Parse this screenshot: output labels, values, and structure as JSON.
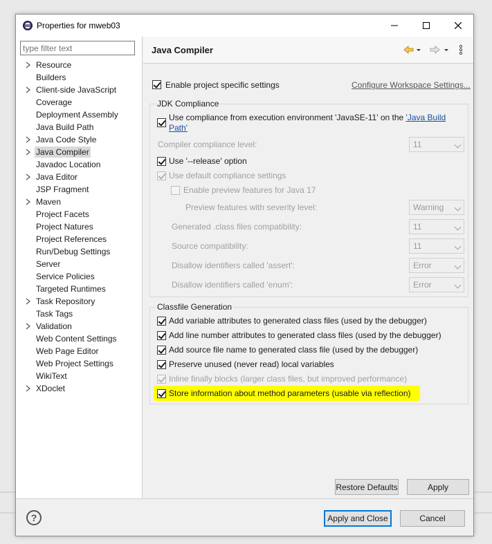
{
  "window": {
    "title": "Properties for mweb03"
  },
  "left": {
    "filter_placeholder": "type filter text",
    "items": [
      {
        "label": "Resource",
        "expandable": true
      },
      {
        "label": "Builders",
        "expandable": false
      },
      {
        "label": "Client-side JavaScript",
        "expandable": true
      },
      {
        "label": "Coverage",
        "expandable": false
      },
      {
        "label": "Deployment Assembly",
        "expandable": false
      },
      {
        "label": "Java Build Path",
        "expandable": false
      },
      {
        "label": "Java Code Style",
        "expandable": true
      },
      {
        "label": "Java Compiler",
        "expandable": true,
        "selected": true
      },
      {
        "label": "Javadoc Location",
        "expandable": false
      },
      {
        "label": "Java Editor",
        "expandable": true
      },
      {
        "label": "JSP Fragment",
        "expandable": false
      },
      {
        "label": "Maven",
        "expandable": true
      },
      {
        "label": "Project Facets",
        "expandable": false
      },
      {
        "label": "Project Natures",
        "expandable": false
      },
      {
        "label": "Project References",
        "expandable": false
      },
      {
        "label": "Run/Debug Settings",
        "expandable": false
      },
      {
        "label": "Server",
        "expandable": false
      },
      {
        "label": "Service Policies",
        "expandable": false
      },
      {
        "label": "Targeted Runtimes",
        "expandable": false
      },
      {
        "label": "Task Repository",
        "expandable": true
      },
      {
        "label": "Task Tags",
        "expandable": false
      },
      {
        "label": "Validation",
        "expandable": true
      },
      {
        "label": "Web Content Settings",
        "expandable": false
      },
      {
        "label": "Web Page Editor",
        "expandable": false
      },
      {
        "label": "Web Project Settings",
        "expandable": false
      },
      {
        "label": "WikiText",
        "expandable": false
      },
      {
        "label": "XDoclet",
        "expandable": true
      }
    ]
  },
  "page": {
    "title": "Java Compiler",
    "enable_specific": "Enable project specific settings",
    "configure_link": "Configure Workspace Settings...",
    "jdk": {
      "group_title": "JDK Compliance",
      "use_compliance_text": "Use compliance from execution environment 'JavaSE-11' on the ",
      "java_build": "'Java Build",
      "path": "Path'",
      "compliance_level_label": "Compiler compliance level:",
      "compliance_level_value": "11",
      "release_option": "Use '--release' option",
      "default_compliance": "Use default compliance settings",
      "enable_preview": "Enable preview features for Java 17",
      "preview_severity_label": "Preview features with severity level:",
      "preview_severity_value": "Warning",
      "generated_label": "Generated .class files compatibility:",
      "generated_value": "11",
      "source_label": "Source compatibility:",
      "source_value": "11",
      "assert_label": "Disallow identifiers called 'assert':",
      "assert_value": "Error",
      "enum_label": "Disallow identifiers called 'enum':",
      "enum_value": "Error"
    },
    "classfile": {
      "group_title": "Classfile Generation",
      "var_attrs": "Add variable attributes to generated class files (used by the debugger)",
      "line_numbers": "Add line number attributes to generated class files (used by the debugger)",
      "source_name": "Add source file name to generated class file (used by the debugger)",
      "preserve_unused": "Preserve unused (never read) local variables",
      "inline_finally": "Inline finally blocks (larger class files, but improved performance)",
      "store_params": "Store information about method parameters (usable via reflection)"
    }
  },
  "buttons": {
    "restore_defaults": "Restore Defaults",
    "apply": "Apply",
    "apply_close": "Apply and Close",
    "cancel": "Cancel",
    "help": "?"
  },
  "colors": {
    "highlight": "#ffff00",
    "link": "#1a4d9c",
    "focus": "#0078d7"
  }
}
